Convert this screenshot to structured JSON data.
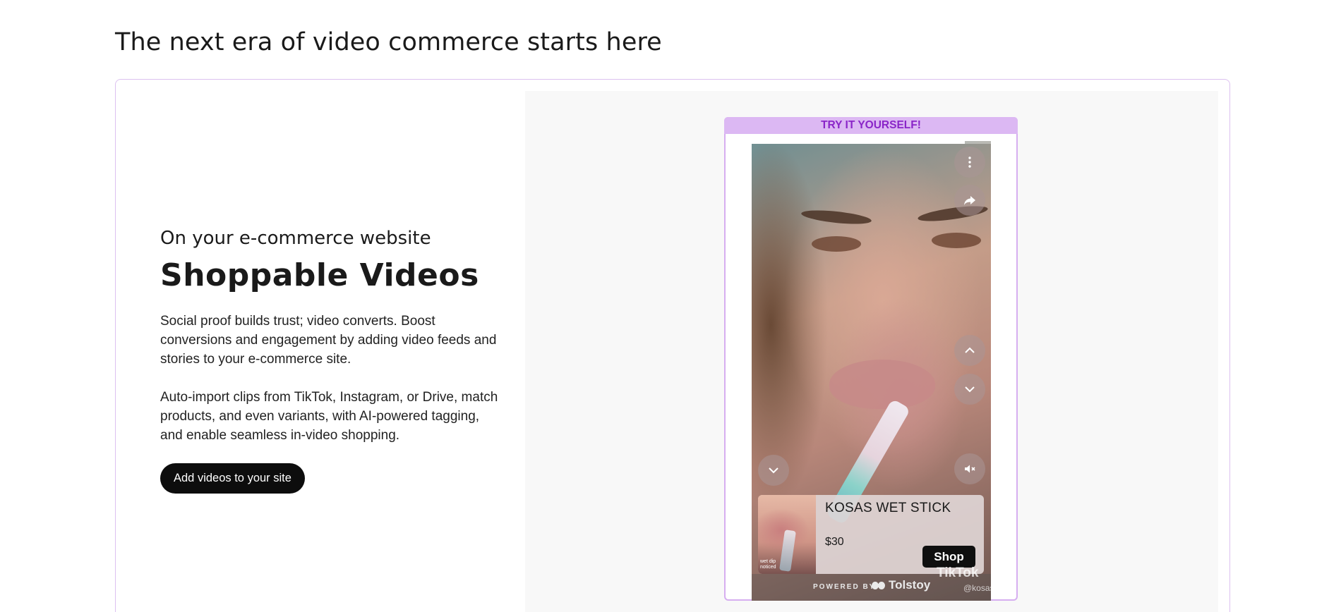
{
  "page": {
    "heading": "The next era of video commerce starts here"
  },
  "feature": {
    "eyebrow": "On your e-commerce website",
    "title": "Shoppable Videos",
    "paragraph_1": "Social proof builds trust; video converts. Boost conversions and engagement by adding video feeds and stories to your e-commerce site.",
    "paragraph_2": "Auto-import clips from TikTok, Instagram, or Drive, match products, and even variants, with AI-powered tagging, and enable seamless in-video shopping.",
    "cta_label": "Add videos to your site"
  },
  "demo": {
    "banner": "TRY IT YOURSELF!",
    "progress": 0.89,
    "controls": {
      "more_icon": "more-vertical-icon",
      "share_icon": "share-icon",
      "prev_icon": "chevron-up-icon",
      "next_icon": "chevron-down-icon",
      "collapse_icon": "chevron-down-icon",
      "mute_icon": "volume-muted-icon"
    },
    "product": {
      "name": "KOSAS WET STICK",
      "price": "$30",
      "shop_label": "Shop",
      "thumb_text_1": "wet dip",
      "thumb_text_2": "noticed"
    },
    "footer": {
      "powered_by": "POWERED BY",
      "brand": "Tolstoy",
      "tiktok": "TikTok",
      "handle": "@kosas"
    }
  },
  "colors": {
    "accent": "#d6aef0",
    "banner_text": "#8a25c8",
    "cta_bg": "#0d0d0d"
  }
}
